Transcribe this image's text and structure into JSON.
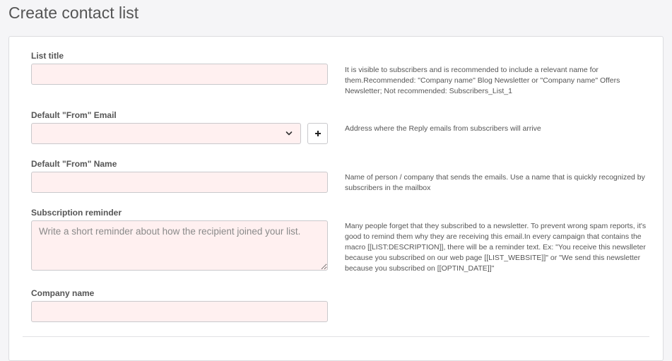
{
  "page": {
    "title": "Create contact list"
  },
  "form": {
    "list_title": {
      "label": "List title",
      "value": "",
      "help": "It is visible to subscribers and is recommended to include a relevant name for them.Recommended: \"Company name\" Blog Newsletter or \"Company name\" Offers Newsletter; Not recommended: Subscribers_List_1"
    },
    "from_email": {
      "label": "Default \"From\" Email",
      "selected": "",
      "add_button_icon": "plus-icon",
      "dropdown_icon": "chevron-down-icon",
      "help": "Address where the Reply emails from subscribers will arrive"
    },
    "from_name": {
      "label": "Default \"From\" Name",
      "value": "",
      "help": "Name of person / company that sends the emails. Use a name that is quickly recognized by subscribers in the mailbox"
    },
    "reminder": {
      "label": "Subscription reminder",
      "placeholder": "Write a short reminder about how the recipient joined your list.",
      "value": "",
      "help": "Many people forget that they subscribed to a newsletter. To prevent wrong spam reports, it's good to remind them why they are receiving this email.In every campaign that contains the macro [[LIST:DESCRIPTION]], there will be a reminder text. Ex: \"You receive this newslleter because you subscribed on our web page [[LIST_WEBSITE]]\" or \"We send this newsletter because you subscribed on [[OPTIN_DATE]]\""
    },
    "company_name": {
      "label": "Company name",
      "value": ""
    }
  },
  "colors": {
    "input_background": "#fff0f0",
    "border": "#c9c9cc",
    "page_background": "#f5f5f7"
  }
}
